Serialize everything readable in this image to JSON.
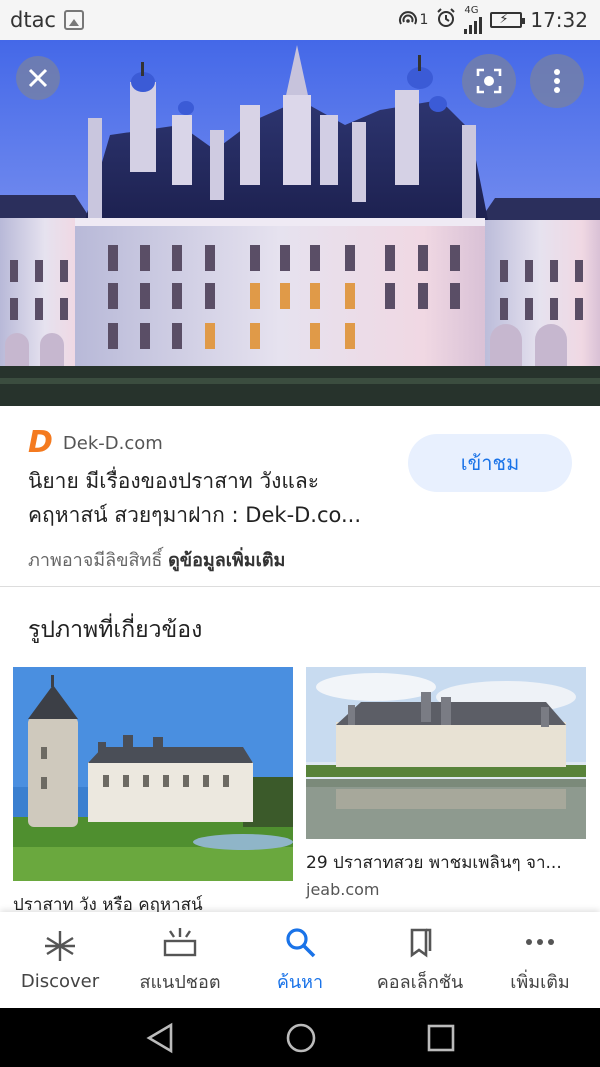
{
  "status_bar": {
    "carrier": "dtac",
    "sim_indicator": "1",
    "network": "4G",
    "time": "17:32",
    "icons": [
      "gallery-icon",
      "hotspot-icon",
      "alarm-icon",
      "signal-icon",
      "battery-charging-icon"
    ]
  },
  "viewer": {
    "close_icon": "close-icon",
    "lens_icon": "lens-icon",
    "more_icon": "more-vertical-icon"
  },
  "result": {
    "source_logo_letter": "D",
    "source_name": "Dek-D.com",
    "title_line1": "นิยาย มีเรื่องของปราสาท วังและ",
    "title_line2": "คฤหาสน์ สวยๆมาฝาก : Dek-D.co...",
    "visit_label": "เข้าชม",
    "rights_text": "ภาพอาจมีลิขสิทธิ์",
    "more_info_label": "ดูข้อมูลเพิ่มเติม"
  },
  "related": {
    "heading": "รูปภาพที่เกี่ยวข้อง",
    "items": [
      {
        "caption": "ปราสาท วัง หรือ คฤหาสน์",
        "site": ""
      },
      {
        "caption": "29 ปราสาทสวย พาชมเพลินๆ จา...",
        "site": "jeab.com"
      }
    ]
  },
  "bottom_nav": {
    "items": [
      {
        "label": "Discover",
        "icon": "asterisk-icon",
        "active": false
      },
      {
        "label": "สแนปชอต",
        "icon": "snapshot-icon",
        "active": false
      },
      {
        "label": "ค้นหา",
        "icon": "search-icon",
        "active": true
      },
      {
        "label": "คอลเล็กชัน",
        "icon": "bookmark-icon",
        "active": false
      },
      {
        "label": "เพิ่มเติม",
        "icon": "more-horizontal-icon",
        "active": false
      }
    ]
  },
  "colors": {
    "accent": "#1a73e8",
    "visit_bg": "#e8f0fe",
    "dekd_orange": "#f47a1f"
  }
}
